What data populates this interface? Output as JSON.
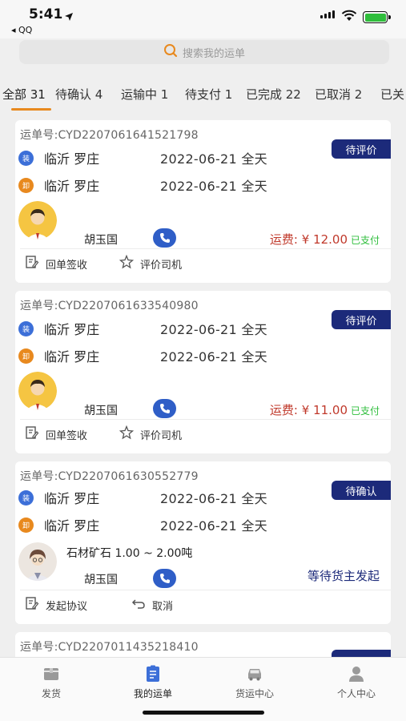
{
  "status_bar": {
    "time": "5:41",
    "back_app": "◂ QQ"
  },
  "search": {
    "placeholder": "搜索我的运单"
  },
  "tabs": [
    {
      "label": "全部 31",
      "active": true
    },
    {
      "label": "待确认 4",
      "active": false
    },
    {
      "label": "运输中 1",
      "active": false
    },
    {
      "label": "待支付 1",
      "active": false
    },
    {
      "label": "已完成 22",
      "active": false
    },
    {
      "label": "已取消 2",
      "active": false
    },
    {
      "label": "已关",
      "active": false
    }
  ],
  "orders": [
    {
      "order_no": "运单号:CYD2207061641521798",
      "badge": "待评价",
      "load_icon": "装",
      "load_city": "临沂 罗庄",
      "load_date": "2022-06-21 全天",
      "unload_icon": "卸",
      "unload_city": "临沂 罗庄",
      "unload_date": "2022-06-21 全天",
      "driver": "胡玉国",
      "fee": "运费: ¥ 12.00",
      "fee_status": "已支付",
      "action1": "回单签收",
      "action2": "评价司机"
    },
    {
      "order_no": "运单号:CYD2207061633540980",
      "badge": "待评价",
      "load_icon": "装",
      "load_city": "临沂 罗庄",
      "load_date": "2022-06-21 全天",
      "unload_icon": "卸",
      "unload_city": "临沂 罗庄",
      "unload_date": "2022-06-21 全天",
      "driver": "胡玉国",
      "fee": "运费: ¥ 11.00",
      "fee_status": "已支付",
      "action1": "回单签收",
      "action2": "评价司机"
    },
    {
      "order_no": "运单号:CYD2207061630552779",
      "badge": "待确认",
      "load_icon": "装",
      "load_city": "临沂 罗庄",
      "load_date": "2022-06-21 全天",
      "unload_icon": "卸",
      "unload_city": "临沂 罗庄",
      "unload_date": "2022-06-21 全天",
      "cargo": "石材矿石 1.00 ~ 2.00吨",
      "driver": "胡玉国",
      "waiting": "等待货主发起",
      "action1": "发起协议",
      "action2": "取消"
    },
    {
      "order_no": "运单号:CYD2207011435218410"
    }
  ],
  "bottom_nav": [
    {
      "label": "发货",
      "icon": "box-icon",
      "active": false
    },
    {
      "label": "我的运单",
      "icon": "document-icon",
      "active": true
    },
    {
      "label": "货运中心",
      "icon": "truck-icon",
      "active": false
    },
    {
      "label": "个人中心",
      "icon": "person-icon",
      "active": false
    }
  ],
  "colors": {
    "accent_orange": "#e8891e",
    "badge_navy": "#1c2a7a",
    "load_blue": "#3c6fd8",
    "paid_green": "#2fbe3c",
    "fee_red": "#c0392b"
  }
}
